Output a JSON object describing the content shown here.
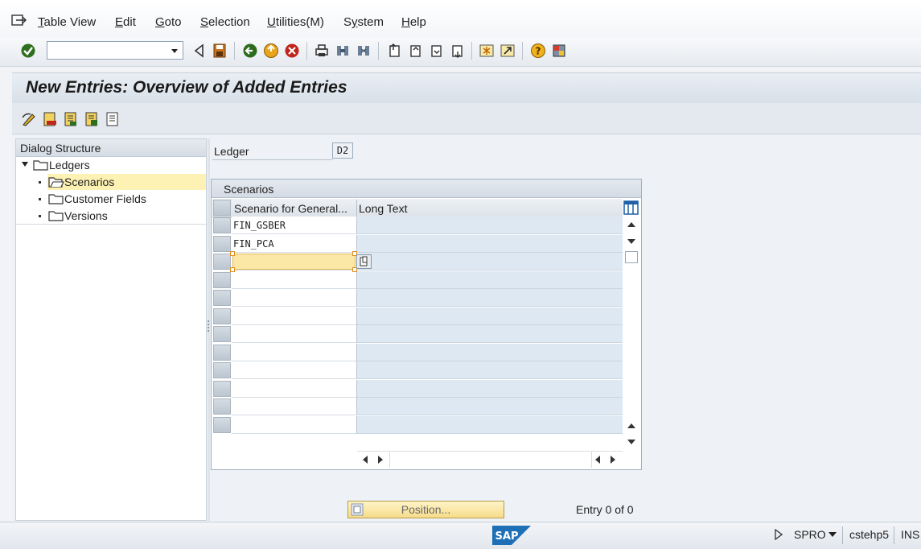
{
  "menu": {
    "items": [
      {
        "pre": "",
        "u": "T",
        "post": "able View"
      },
      {
        "pre": "",
        "u": "E",
        "post": "dit"
      },
      {
        "pre": "",
        "u": "G",
        "post": "oto"
      },
      {
        "pre": "",
        "u": "S",
        "post": "election"
      },
      {
        "pre": "",
        "u": "U",
        "post": "tilities(M)"
      },
      {
        "pre": "S",
        "u": "y",
        "post": "stem"
      },
      {
        "pre": "",
        "u": "H",
        "post": "elp"
      }
    ]
  },
  "toolbar": {
    "command_value": ""
  },
  "page": {
    "title": "New Entries: Overview of Added Entries"
  },
  "dialog_structure": {
    "header": "Dialog Structure",
    "root": "Ledgers",
    "children": [
      "Scenarios",
      "Customer Fields",
      "Versions"
    ],
    "selected": "Scenarios"
  },
  "ledger": {
    "label": "Ledger",
    "value": "D2"
  },
  "table": {
    "title": "Scenarios",
    "columns": [
      "Scenario for General...",
      "Long Text"
    ],
    "rows": [
      [
        "FIN_GSBER",
        ""
      ],
      [
        "FIN_PCA",
        ""
      ],
      [
        "",
        ""
      ],
      [
        "",
        ""
      ],
      [
        "",
        ""
      ],
      [
        "",
        ""
      ],
      [
        "",
        ""
      ],
      [
        "",
        ""
      ],
      [
        "",
        ""
      ],
      [
        "",
        ""
      ],
      [
        "",
        ""
      ],
      [
        "",
        ""
      ]
    ]
  },
  "footer": {
    "position_label": "Position...",
    "entry_text": "Entry 0 of 0"
  },
  "status": {
    "transaction": "SPRO",
    "server": "cstehp5",
    "mode": "INS",
    "logo": "SAP"
  },
  "colors": {
    "accent": "#f0ab00",
    "sap_blue": "#1f6fb7",
    "title_bg": "#dfe6ee"
  }
}
